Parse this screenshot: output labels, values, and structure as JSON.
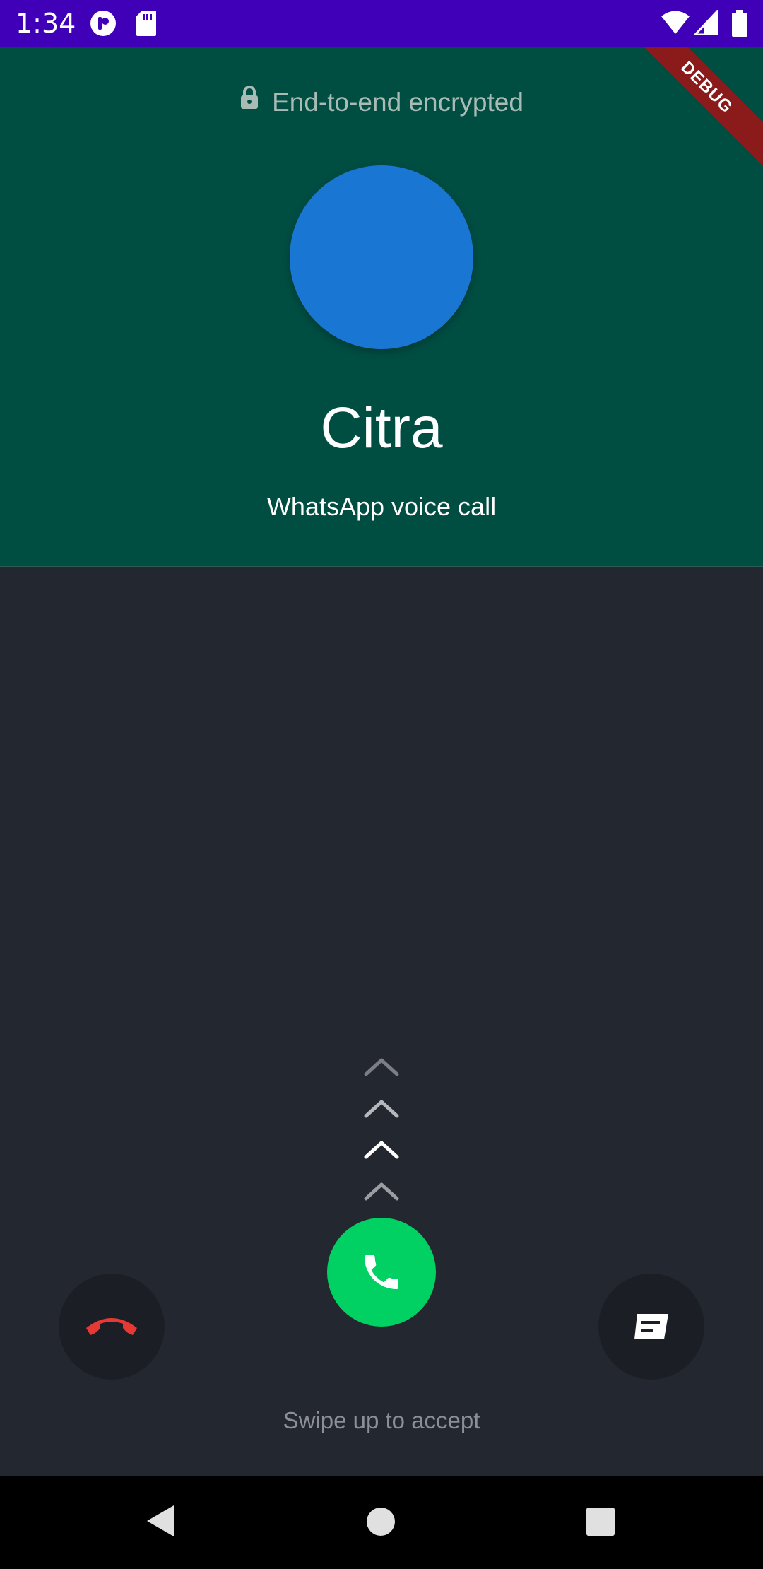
{
  "status_bar": {
    "time": "1:34",
    "left_icons": [
      "app-notification-icon",
      "sd-card-icon"
    ],
    "right_icons": [
      "wifi-icon",
      "signal-icon",
      "battery-icon"
    ],
    "background_color": "#3f00b8"
  },
  "header": {
    "encryption_label": "End-to-end encrypted",
    "caller_name": "Citra",
    "call_type": "WhatsApp voice call",
    "debug_label": "DEBUG",
    "avatar_color": "#1976d2",
    "background_color": "#004d42"
  },
  "actions": {
    "decline_icon": "call-end-icon",
    "accept_icon": "phone-icon",
    "message_icon": "message-icon",
    "accept_color": "#00d162",
    "decline_icon_color": "#e53935"
  },
  "swipe": {
    "hint": "Swipe up to accept",
    "chevron_count": 4
  },
  "nav_bar": {
    "icons": [
      "back-icon",
      "home-icon",
      "recents-icon"
    ]
  }
}
